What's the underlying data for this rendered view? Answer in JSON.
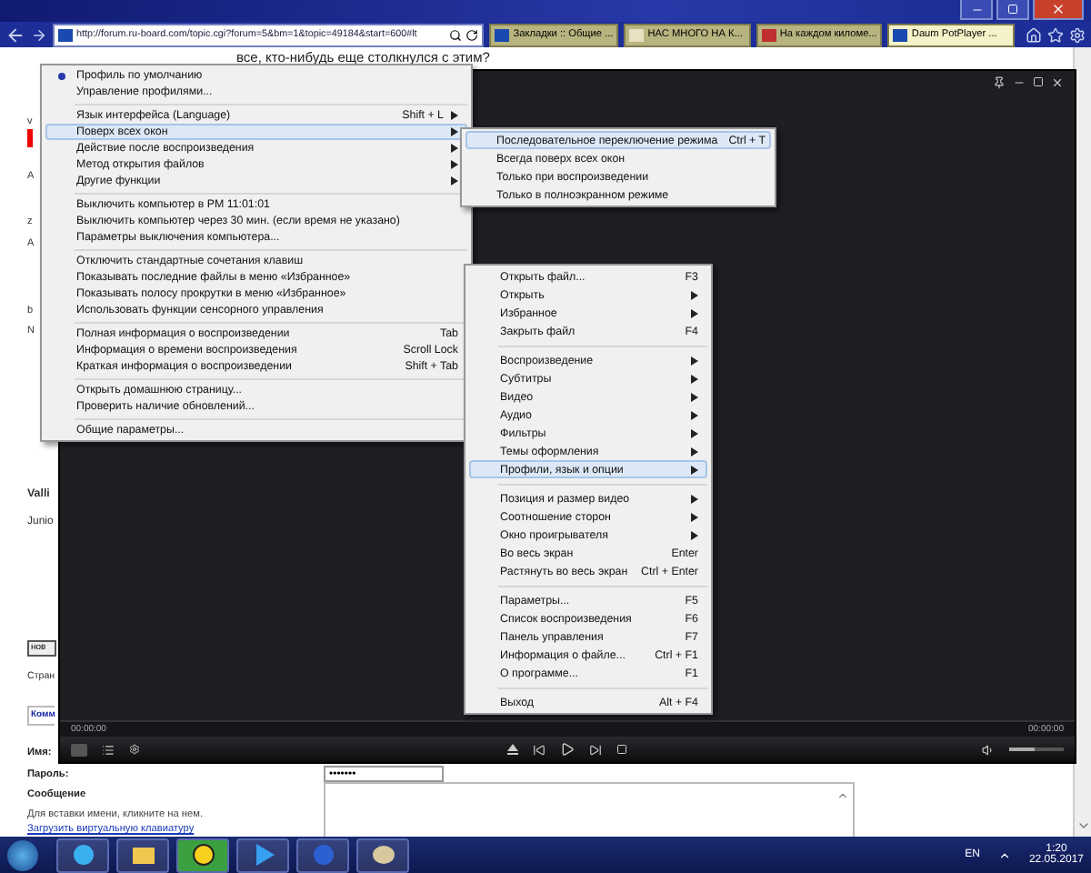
{
  "browser": {
    "address": "http://forum.ru-board.com/topic.cgi?forum=5&bm=1&topic=49184&start=600#lt",
    "tabs": [
      {
        "label": "Закладки :: Общие ...",
        "selected": false
      },
      {
        "label": "НАС МНОГО НА К...",
        "selected": false
      },
      {
        "label": "На каждом киломе...",
        "selected": false
      },
      {
        "label": "Daum PotPlayer ...",
        "selected": true
      }
    ]
  },
  "page": {
    "question": "все, кто-нибудь еще столкнулся с этим?",
    "left_fragments": [
      "v",
      "A",
      "z",
      "A",
      "b",
      "N"
    ],
    "author": "Valli",
    "rank": "Junio",
    "new_button": "нов",
    "pages": "Стран",
    "comment_heading": "Комм",
    "name_label": "Имя:",
    "password_label": "Пароль:",
    "password_value": "•••••••",
    "message_label": "Сообщение",
    "hint": "Для вставки имени, кликните на нем.",
    "keyboard_link": "Загрузить виртуальную клавиатуру"
  },
  "player": {
    "time_elapsed": "00:00:00",
    "time_total": "00:00:00",
    "volume": {
      "level": 0.45
    }
  },
  "main_menu": {
    "sections": [
      [
        {
          "label": "Профиль по умолчанию",
          "checked": true,
          "submenu": false,
          "selected": false
        },
        {
          "label": "Управление профилями...",
          "checked": false,
          "submenu": false,
          "selected": false
        }
      ],
      [
        {
          "label": "Язык интерфейса (Language)",
          "shortcut": "Shift + L",
          "checked": false,
          "submenu": true,
          "selected": false
        },
        {
          "label": "Поверх всех окон",
          "checked": false,
          "submenu": true,
          "selected": true
        },
        {
          "label": "Действие после воспроизведения",
          "checked": false,
          "submenu": true,
          "selected": false
        },
        {
          "label": "Метод открытия файлов",
          "checked": false,
          "submenu": true,
          "selected": false
        },
        {
          "label": "Другие функции",
          "checked": false,
          "submenu": true,
          "selected": false
        }
      ],
      [
        {
          "label": "Выключить компьютер в PM 11:01:01",
          "checked": false,
          "submenu": false,
          "selected": false
        },
        {
          "label": "Выключить компьютер через 30  мин. (если время не указано)",
          "checked": false,
          "submenu": false,
          "selected": false
        },
        {
          "label": "Параметры выключения компьютера...",
          "checked": false,
          "submenu": false,
          "selected": false
        }
      ],
      [
        {
          "label": "Отключить стандартные сочетания клавиш",
          "checked": false,
          "submenu": false,
          "selected": false
        },
        {
          "label": "Показывать последние файлы в меню «Избранное»",
          "checked": false,
          "submenu": false,
          "selected": false
        },
        {
          "label": "Показывать полосу прокрутки в меню «Избранное»",
          "checked": false,
          "submenu": false,
          "selected": false
        },
        {
          "label": "Использовать функции сенсорного управления",
          "checked": false,
          "submenu": false,
          "selected": false
        }
      ],
      [
        {
          "label": "Полная информация о воспроизведении",
          "shortcut": "Tab",
          "checked": false,
          "submenu": false,
          "selected": false
        },
        {
          "label": "Информация о времени воспроизведения",
          "shortcut": "Scroll Lock",
          "checked": false,
          "submenu": false,
          "selected": false
        },
        {
          "label": "Краткая информация о воспроизведении",
          "shortcut": "Shift + Tab",
          "checked": false,
          "submenu": false,
          "selected": false
        }
      ],
      [
        {
          "label": "Открыть домашнюю страницу...",
          "checked": false,
          "submenu": false,
          "selected": false
        },
        {
          "label": "Проверить наличие обновлений...",
          "checked": false,
          "submenu": false,
          "selected": false
        }
      ],
      [
        {
          "label": "Общие параметры...",
          "checked": false,
          "submenu": false,
          "selected": false
        }
      ]
    ]
  },
  "topmost_submenu": {
    "sections": [
      [
        {
          "label": "Последовательное переключение режима",
          "shortcut": "Ctrl + T",
          "submenu": false,
          "selected": true
        },
        {
          "label": "Всегда поверх всех окон",
          "submenu": false,
          "selected": false
        },
        {
          "label": "Только при воспроизведении",
          "submenu": false,
          "selected": false
        },
        {
          "label": "Только в полноэкранном режиме",
          "submenu": false,
          "selected": false
        }
      ]
    ]
  },
  "context_menu": {
    "sections": [
      [
        {
          "label": "Открыть файл...",
          "shortcut": "F3",
          "submenu": false,
          "selected": false
        },
        {
          "label": "Открыть",
          "submenu": true,
          "selected": false
        },
        {
          "label": "Избранное",
          "submenu": true,
          "selected": false
        },
        {
          "label": "Закрыть файл",
          "shortcut": "F4",
          "submenu": false,
          "selected": false
        }
      ],
      [
        {
          "label": "Воспроизведение",
          "submenu": true,
          "selected": false
        },
        {
          "label": "Субтитры",
          "submenu": true,
          "selected": false
        },
        {
          "label": "Видео",
          "submenu": true,
          "selected": false
        },
        {
          "label": "Аудио",
          "submenu": true,
          "selected": false
        },
        {
          "label": "Фильтры",
          "submenu": true,
          "selected": false
        },
        {
          "label": "Темы оформления",
          "submenu": true,
          "selected": false
        },
        {
          "label": "Профили, язык и опции",
          "submenu": true,
          "selected": true
        }
      ],
      [
        {
          "label": "Позиция и размер видео",
          "submenu": true,
          "selected": false
        },
        {
          "label": "Соотношение сторон",
          "submenu": true,
          "selected": false
        },
        {
          "label": "Окно проигрывателя",
          "submenu": true,
          "selected": false
        },
        {
          "label": "Во весь экран",
          "shortcut": "Enter",
          "submenu": false,
          "selected": false
        },
        {
          "label": "Растянуть во весь экран",
          "shortcut": "Ctrl + Enter",
          "submenu": false,
          "selected": false
        }
      ],
      [
        {
          "label": "Параметры...",
          "shortcut": "F5",
          "submenu": false,
          "selected": false
        },
        {
          "label": "Список воспроизведения",
          "shortcut": "F6",
          "submenu": false,
          "selected": false
        },
        {
          "label": "Панель управления",
          "shortcut": "F7",
          "submenu": false,
          "selected": false
        },
        {
          "label": "Информация о файле...",
          "shortcut": "Ctrl + F1",
          "submenu": false,
          "selected": false
        },
        {
          "label": "О программе...",
          "shortcut": "F1",
          "submenu": false,
          "selected": false
        }
      ],
      [
        {
          "label": "Выход",
          "shortcut": "Alt + F4",
          "submenu": false,
          "selected": false
        }
      ]
    ]
  },
  "taskbar": {
    "language": "EN",
    "time": "1:20",
    "date": "22.05.2017"
  }
}
